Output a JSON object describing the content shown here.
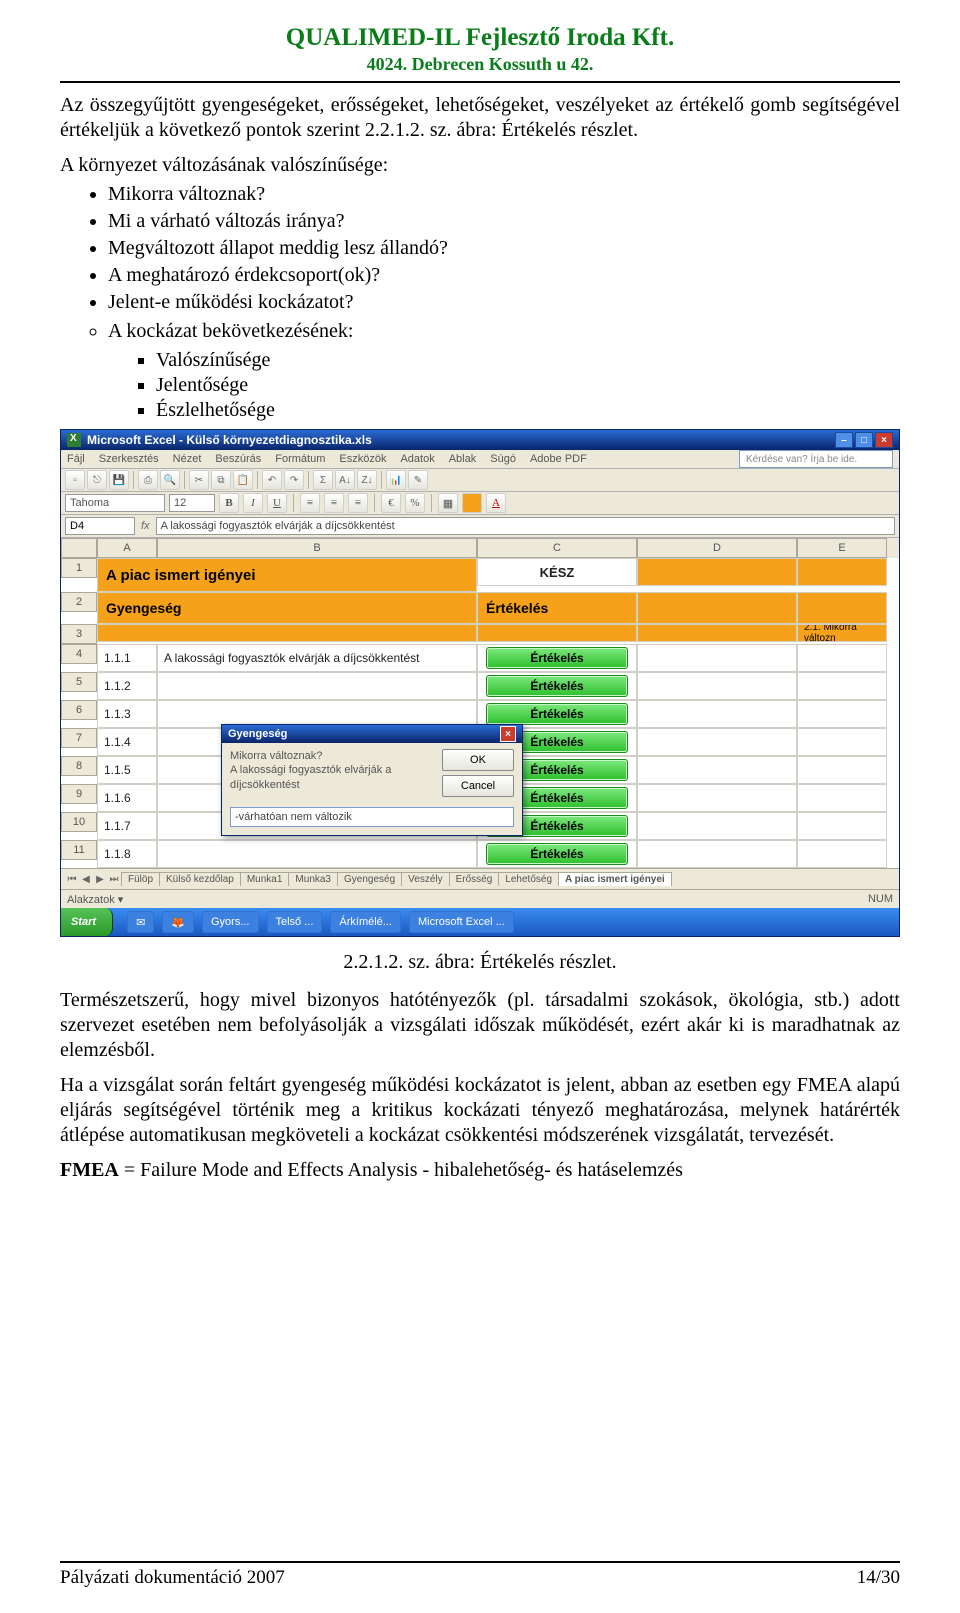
{
  "header": {
    "line1": "QUALIMED-IL Fejlesztő Iroda Kft.",
    "line2": "4024. Debrecen Kossuth u 42."
  },
  "para1": "Az összegyűjtött gyengeségeket, erősségeket, lehetőségeket, veszélyeket az értékelő gomb segítségével értékeljük a következő pontok szerint 2.2.1.2. sz. ábra: Értékelés részlet.",
  "list_intro": "A környezet változásának valószínűsége:",
  "bullets": [
    "Mikorra változnak?",
    "Mi a várható változás iránya?",
    "Megváltozott állapot meddig lesz állandó?",
    "A meghatározó érdekcsoport(ok)?",
    "Jelent-e működési kockázatot?"
  ],
  "subbullet_intro": "A kockázat bekövetkezésének:",
  "subbullets": [
    "Valószínűsége",
    "Jelentősége",
    "Észlelhetősége"
  ],
  "caption": "2.2.1.2. sz. ábra: Értékelés részlet.",
  "para2": "Természetszerű, hogy mivel bizonyos hatótényezők (pl. társadalmi szokások, ökológia, stb.) adott szervezet esetében nem befolyásolják a vizsgálati időszak működését, ezért akár ki is maradhatnak az elemzésből.",
  "para3": "Ha a vizsgálat során feltárt gyengeség működési kockázatot is jelent, abban az esetben egy FMEA alapú eljárás segítségével történik meg a kritikus kockázati tényező meghatározása, melynek határérték átlépése automatikusan megköveteli a kockázat csökkentési módszerének vizsgálatát, tervezését.",
  "para4_prefix": "FMEA",
  "para4_rest": " = Failure Mode and Effects Analysis - hibalehetőség- és hatáselemzés",
  "footer_left": "Pályázati dokumentáció 2007",
  "footer_right": "14/30",
  "excel": {
    "title": "Microsoft Excel - Külső környezetdiagnosztika.xls",
    "menus": [
      "Fájl",
      "Szerkesztés",
      "Nézet",
      "Beszúrás",
      "Formátum",
      "Eszközök",
      "Adatok",
      "Ablak",
      "Súgó",
      "Adobe PDF"
    ],
    "question_placeholder": "Kérdése van? Írja be ide.",
    "font_name": "Tahoma",
    "font_size": "12",
    "cell_ref": "D4",
    "formula_text": "A lakossági fogyasztók elvárják a díjcsökkentést",
    "col_headers": [
      "A",
      "B",
      "C",
      "D",
      "E"
    ],
    "row_numbers": [
      "1",
      "2",
      "3",
      "4",
      "5",
      "6",
      "7",
      "8",
      "9",
      "10",
      "11"
    ],
    "title_row": "A piac ismert igényei",
    "status_word": "KÉSZ",
    "sub_left": "Gyengeség",
    "sub_right": "Értékelés",
    "next_section": "2.1. Mikorra változn",
    "data_rows": [
      {
        "num": "1.1.1",
        "text": "A lakossági fogyasztók elvárják a díjcsökkentést"
      },
      {
        "num": "1.1.2",
        "text": ""
      },
      {
        "num": "1.1.3",
        "text": ""
      },
      {
        "num": "1.1.4",
        "text": ""
      },
      {
        "num": "1.1.5",
        "text": ""
      },
      {
        "num": "1.1.6",
        "text": ""
      },
      {
        "num": "1.1.7",
        "text": ""
      },
      {
        "num": "1.1.8",
        "text": ""
      }
    ],
    "green_label": "Értékelés",
    "sheet_tabs": [
      "Fülöp",
      "Külső kezdőlap",
      "Munka1",
      "Munka3",
      "Gyengeség",
      "Veszély",
      "Erősség",
      "Lehetőség",
      "A piac ismert igényei"
    ],
    "active_tab_index": 8,
    "statusbar_text": "",
    "statusbar_right": "NUM",
    "dialog": {
      "title": "Gyengeség",
      "line1": "Mikorra változnak?",
      "line2": "A lakossági fogyasztók elvárják a díjcsökkentést",
      "input_value": "-várhatóan nem változik",
      "ok": "OK",
      "cancel": "Cancel"
    },
    "taskbar": {
      "start": "Start",
      "items": [
        "Gyors...",
        "Telső ...",
        "Árkímélé...",
        "?",
        "?",
        "Microsoft Excel ..."
      ]
    }
  }
}
